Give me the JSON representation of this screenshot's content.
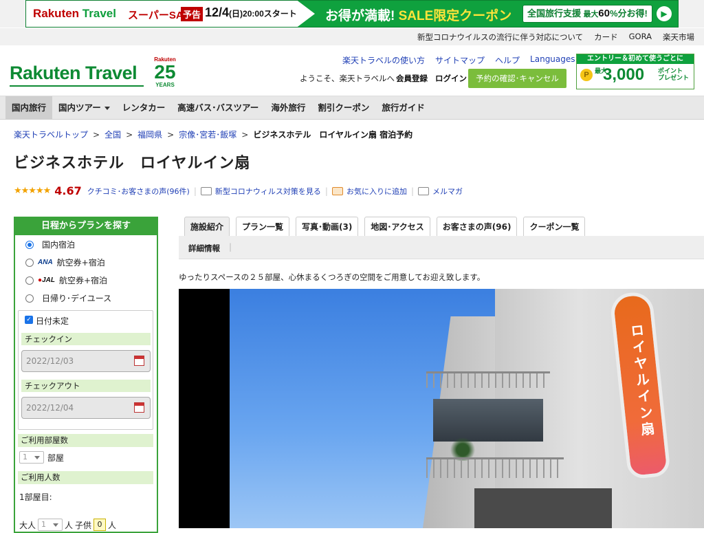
{
  "banner": {
    "logo_a": "Rakuten",
    "logo_b": " Travel",
    "sale": "スーパーSALE",
    "notice": "予告",
    "date": "12/4",
    "weekday": "(日)",
    "time": "20:00スタート",
    "right_a": "お得が満載! ",
    "right_b": "SALE",
    "right_c": "限定クーポン",
    "coupon_label": "全国旅行支援",
    "coupon_pct_prefix": "最大",
    "coupon_pct": "60",
    "coupon_suffix": "%分お得!",
    "go_icon": "play-arrow"
  },
  "util": {
    "items": [
      "新型コロナウイルスの流行に伴う対応について",
      "カード",
      "GORA",
      "楽天市場"
    ]
  },
  "header": {
    "logo": "Rakuten Travel",
    "anniv_top": "Rakuten",
    "anniv_num": "25",
    "anniv_bottom": "YEARS",
    "links": [
      "楽天トラベルの使い方",
      "サイトマップ",
      "ヘルプ",
      "Languages"
    ],
    "welcome": "ようこそ、楽天トラベルへ",
    "register": "会員登録",
    "login": "ログイン",
    "reservation": "予約の確認･キャンセル",
    "promo_head": "エントリー＆初めて使うごとに",
    "promo_coin": "P",
    "promo_small": "最大",
    "promo_big": "3,000",
    "promo_unit_1": "ポイント",
    "promo_unit_2": "プレゼント"
  },
  "nav": {
    "items": [
      "国内旅行",
      "国内ツアー",
      "レンタカー",
      "高速バス･バスツアー",
      "海外旅行",
      "割引クーポン",
      "旅行ガイド"
    ],
    "active": "国内旅行"
  },
  "breadcrumb": {
    "items": [
      "楽天トラベルトップ",
      "全国",
      "福岡県",
      "宗像･宮若･飯塚"
    ],
    "current": "ビジネスホテル　ロイヤルイン扇 宿泊予約",
    "separator": ">"
  },
  "hotel": {
    "title": "ビジネスホテル　ロイヤルイン扇",
    "stars": "★★★★★",
    "score": "4.67",
    "reviews": "クチコミ･お客さまの声(96件)",
    "covid": "新型コロナウィルス対策を見る",
    "favorite": "お気に入りに追加",
    "mailmag": "メルマガ"
  },
  "search": {
    "title": "日程からプランを探す",
    "options": [
      "国内宿泊",
      "航空券+宿泊",
      "航空券+宿泊",
      "日帰り･デイユース"
    ],
    "ana": "ANA",
    "jal": "JAL",
    "date_undecided": "日付未定",
    "checkin_label": "チェックイン",
    "checkin_value": "2022/12/03",
    "checkout_label": "チェックアウト",
    "checkout_value": "2022/12/04",
    "rooms_label": "ご利用部屋数",
    "rooms_value": "1",
    "rooms_unit": "部屋",
    "guests_label": "ご利用人数",
    "room1": "1部屋目:",
    "adult": "大人",
    "adult_value": "1",
    "adult_unit": "人",
    "child": "子供",
    "child_value": "0",
    "child_unit": "人"
  },
  "tabs": {
    "items": [
      "施設紹介",
      "プラン一覧",
      "写真･動画(3)",
      "地図･アクセス",
      "お客さまの声(96)",
      "クーポン一覧"
    ],
    "active": "施設紹介",
    "sub": "詳細情報",
    "sub_sep": "|"
  },
  "description": "ゆったりスペースの２５部屋、心休まるくつろぎの空間をご用意してお迎え致します。",
  "photo": {
    "sign_text": "ロイヤルイン扇"
  }
}
